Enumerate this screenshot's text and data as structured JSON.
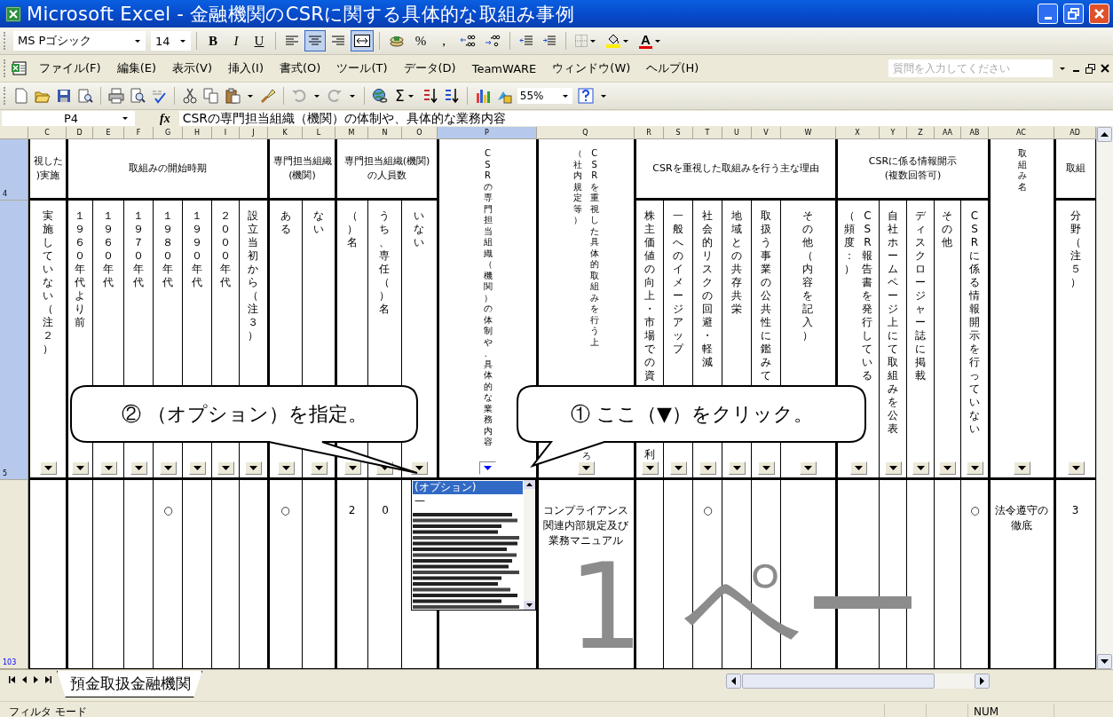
{
  "window": {
    "title": "Microsoft Excel - 金融機関のCSRに関する具体的な取組み事例"
  },
  "formatting_toolbar": {
    "font": "MS Pゴシック",
    "size": "14",
    "buttons": [
      {
        "kind": "bold",
        "label": "B",
        "pressed": false
      },
      {
        "kind": "italic",
        "label": "I",
        "pressed": false
      },
      {
        "kind": "underline",
        "label": "U",
        "pressed": false
      },
      {
        "kind": "align-left",
        "pressed": false
      },
      {
        "kind": "align-center",
        "pressed": true
      },
      {
        "kind": "align-right",
        "pressed": false
      },
      {
        "kind": "merge",
        "pressed": true
      },
      {
        "kind": "currency",
        "pressed": false
      },
      {
        "kind": "percent",
        "label": "%",
        "pressed": false
      },
      {
        "kind": "comma",
        "label": ",",
        "pressed": false
      },
      {
        "kind": "decimal-increase",
        "pressed": false
      },
      {
        "kind": "decimal-decrease",
        "pressed": false
      },
      {
        "kind": "indent-decrease",
        "pressed": false
      },
      {
        "kind": "indent-increase",
        "pressed": false
      },
      {
        "kind": "borders",
        "pressed": false
      },
      {
        "kind": "fill-color",
        "pressed": false
      },
      {
        "kind": "font-color",
        "label": "A",
        "pressed": false
      }
    ]
  },
  "menu": {
    "items": [
      "ファイル(F)",
      "編集(E)",
      "表示(V)",
      "挿入(I)",
      "書式(O)",
      "ツール(T)",
      "データ(D)",
      "TeamWARE",
      "ウィンドウ(W)",
      "ヘルプ(H)"
    ],
    "help_placeholder": "質問を入力してください"
  },
  "standard_toolbar": {
    "sum_label": "Σ",
    "zoom": "55%"
  },
  "formula_bar": {
    "name_box": "P4",
    "fx_label": "fx",
    "content": "CSRの専門担当組織（機関）の体制や、具体的な業務内容"
  },
  "sheet": {
    "column_headers": [
      {
        "label": "C",
        "selected": false
      },
      {
        "label": "D",
        "selected": false
      },
      {
        "label": "E",
        "selected": false
      },
      {
        "label": "F",
        "selected": false
      },
      {
        "label": "G",
        "selected": false
      },
      {
        "label": "H",
        "selected": false
      },
      {
        "label": "I",
        "selected": false
      },
      {
        "label": "J",
        "selected": false
      },
      {
        "label": "K",
        "selected": false
      },
      {
        "label": "L",
        "selected": false
      },
      {
        "label": "M",
        "selected": false
      },
      {
        "label": "N",
        "selected": false
      },
      {
        "label": "O",
        "selected": false
      },
      {
        "label": "P",
        "selected": true
      },
      {
        "label": "Q",
        "selected": false
      },
      {
        "label": "R",
        "selected": false
      },
      {
        "label": "S",
        "selected": false
      },
      {
        "label": "T",
        "selected": false
      },
      {
        "label": "U",
        "selected": false
      },
      {
        "label": "V",
        "selected": false
      },
      {
        "label": "W",
        "selected": false
      },
      {
        "label": "X",
        "selected": false
      },
      {
        "label": "Y",
        "selected": false
      },
      {
        "label": "Z",
        "selected": false
      },
      {
        "label": "AA",
        "selected": false
      },
      {
        "label": "AB",
        "selected": false
      },
      {
        "label": "AC",
        "selected": false
      },
      {
        "label": "AD",
        "selected": false
      }
    ],
    "rows": [
      {
        "label": "4",
        "selected": true,
        "filtered": false
      },
      {
        "label": "5",
        "selected": true,
        "filtered": false
      },
      {
        "label": "103",
        "selected": false,
        "filtered": true
      }
    ],
    "header_groups": [
      {
        "kind": "group",
        "text": "視した\n)実施",
        "columns": [
          {
            "text": "実施していない（注２）",
            "filter_open": false
          }
        ]
      },
      {
        "kind": "group",
        "text": "取組みの開始時期",
        "columns": [
          {
            "text": "１９６０年代より前",
            "filter_open": false
          },
          {
            "text": "１９６０年代",
            "filter_open": false
          },
          {
            "text": "１９７０年代",
            "filter_open": false
          },
          {
            "text": "１９８０年代",
            "filter_open": false
          },
          {
            "text": "１９９０年代",
            "filter_open": false
          },
          {
            "text": "２０００年代",
            "filter_open": false
          },
          {
            "text": "設立当初から（注３）",
            "filter_open": false
          }
        ]
      },
      {
        "kind": "group",
        "text": "専門担当組織(機関)",
        "columns": [
          {
            "text": "ある",
            "filter_open": false
          },
          {
            "text": "ない",
            "filter_open": false
          }
        ]
      },
      {
        "kind": "group",
        "text": "専門担当組織(機関)\nの人員数",
        "columns": [
          {
            "text": "（）名",
            "filter_open": false
          },
          {
            "text": "うち、専任（）名",
            "filter_open": false
          },
          {
            "text": "いない",
            "filter_open": false
          }
        ]
      },
      {
        "kind": "merged",
        "text": "CSRの専門担当組織（機関）の体制や、具体的な業務内容",
        "filter_open": true
      },
      {
        "kind": "merged",
        "text": "CSRを重視した具体的取組みを行う上",
        "side": "（社内規定等）",
        "tail": "ろ",
        "filter_open": false
      },
      {
        "kind": "group",
        "text": "CSRを重視した取組みを行う主な理由",
        "columns": [
          {
            "text": "株主価値の向上・市場での資",
            "tail": "利",
            "filter_open": false
          },
          {
            "text": "一般へのイメージアップ",
            "filter_open": false
          },
          {
            "text": "社会的リスクの回避・軽減",
            "filter_open": false
          },
          {
            "text": "地域との共存共栄",
            "filter_open": false
          },
          {
            "text": "取扱う事業の公共性に鑑みて",
            "filter_open": false
          },
          {
            "text": "その他（内容を記入）",
            "filter_open": false
          }
        ]
      },
      {
        "kind": "group",
        "text": "CSRに係る情報開示\n(複数回答可)",
        "columns": [
          {
            "text": "CSR報告書を発行している",
            "side": "（頻度：）",
            "filter_open": false
          },
          {
            "text": "自社ホームページ上にて取組みを公表",
            "filter_open": false
          },
          {
            "text": "ディスクロージャー誌に掲載",
            "filter_open": false
          },
          {
            "text": "その他",
            "filter_open": false
          },
          {
            "text": "CSRに係る情報開示を行っていない",
            "filter_open": false
          }
        ]
      },
      {
        "kind": "merged",
        "text": "取組み名",
        "filter_open": false
      },
      {
        "kind": "group",
        "text": "取組",
        "columns": [
          {
            "text": "分野（注５）",
            "filter_open": false
          }
        ]
      }
    ],
    "data_row": {
      "cells": [
        {},
        {},
        {},
        {},
        {
          "text": "○"
        },
        {},
        {},
        {},
        {
          "text": "○"
        },
        {},
        {
          "text": "2"
        },
        {
          "text": "0"
        },
        {},
        {},
        {
          "text": "コンプライアンス関連内部規定及び業務マニュアル"
        },
        {},
        {},
        {
          "text": "○"
        },
        {},
        {},
        {},
        {},
        {},
        {},
        {},
        {
          "text": "○"
        },
        {
          "text": "法令遵守の徹底"
        },
        {
          "text": "3"
        }
      ]
    },
    "filter_dropdown": {
      "items": [
        {
          "label": "(オプション)",
          "selected": true
        },
        {
          "label": "—",
          "selected": false
        }
      ]
    },
    "callouts": [
      {
        "text": "② （オプション）を指定。"
      },
      {
        "text": "① ここ（▼）をクリック。"
      }
    ],
    "page_label": "1 ペー"
  },
  "sheet_tabs": [
    {
      "label": "預金取扱金融機関",
      "selected": true
    }
  ],
  "status_bar": {
    "mode": "フィルタ モード",
    "num": "NUM"
  }
}
